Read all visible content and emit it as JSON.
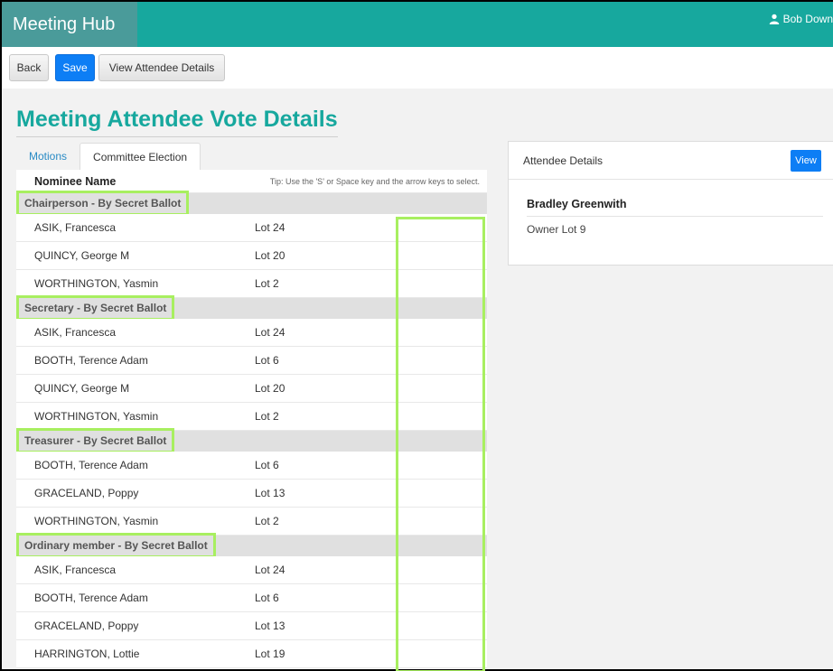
{
  "app": {
    "title": "Meeting Hub",
    "user_name": "Bob Down"
  },
  "toolbar": {
    "back_label": "Back",
    "save_label": "Save",
    "view_attendee_label": "View Attendee Details"
  },
  "page": {
    "title": "Meeting Attendee Vote Details"
  },
  "tabs": [
    {
      "label": "Motions",
      "active": false
    },
    {
      "label": "Committee Election",
      "active": true
    }
  ],
  "grid": {
    "name_header": "Nominee Name",
    "tip": "Tip: Use the 'S' or Space key and the arrow keys to select.",
    "groups": [
      {
        "label": "Chairperson - By Secret Ballot",
        "rows": [
          {
            "name": "ASIK, Francesca",
            "lot": "Lot 24"
          },
          {
            "name": "QUINCY, George M",
            "lot": "Lot 20"
          },
          {
            "name": "WORTHINGTON, Yasmin",
            "lot": "Lot 2"
          }
        ]
      },
      {
        "label": "Secretary - By Secret Ballot",
        "rows": [
          {
            "name": "ASIK, Francesca",
            "lot": "Lot 24"
          },
          {
            "name": "BOOTH, Terence Adam",
            "lot": "Lot 6"
          },
          {
            "name": "QUINCY, George M",
            "lot": "Lot 20"
          },
          {
            "name": "WORTHINGTON, Yasmin",
            "lot": "Lot 2"
          }
        ]
      },
      {
        "label": "Treasurer - By Secret Ballot",
        "rows": [
          {
            "name": "BOOTH, Terence Adam",
            "lot": "Lot 6"
          },
          {
            "name": "GRACELAND, Poppy",
            "lot": "Lot 13"
          },
          {
            "name": "WORTHINGTON, Yasmin",
            "lot": "Lot 2"
          }
        ]
      },
      {
        "label": "Ordinary member - By Secret Ballot",
        "rows": [
          {
            "name": "ASIK, Francesca",
            "lot": "Lot 24"
          },
          {
            "name": "BOOTH, Terence Adam",
            "lot": "Lot 6"
          },
          {
            "name": "GRACELAND, Poppy",
            "lot": "Lot 13"
          },
          {
            "name": "HARRINGTON, Lottie",
            "lot": "Lot 19"
          }
        ]
      }
    ]
  },
  "attendee_panel": {
    "title": "Attendee Details",
    "view_label": "View",
    "name": "Bradley Greenwith",
    "info": "Owner  Lot 9"
  },
  "colors": {
    "brand_teal": "#17a89e",
    "primary_blue": "#0d7ef5",
    "highlight_green": "#a8ef60"
  },
  "icons": {
    "user": "user-icon"
  }
}
